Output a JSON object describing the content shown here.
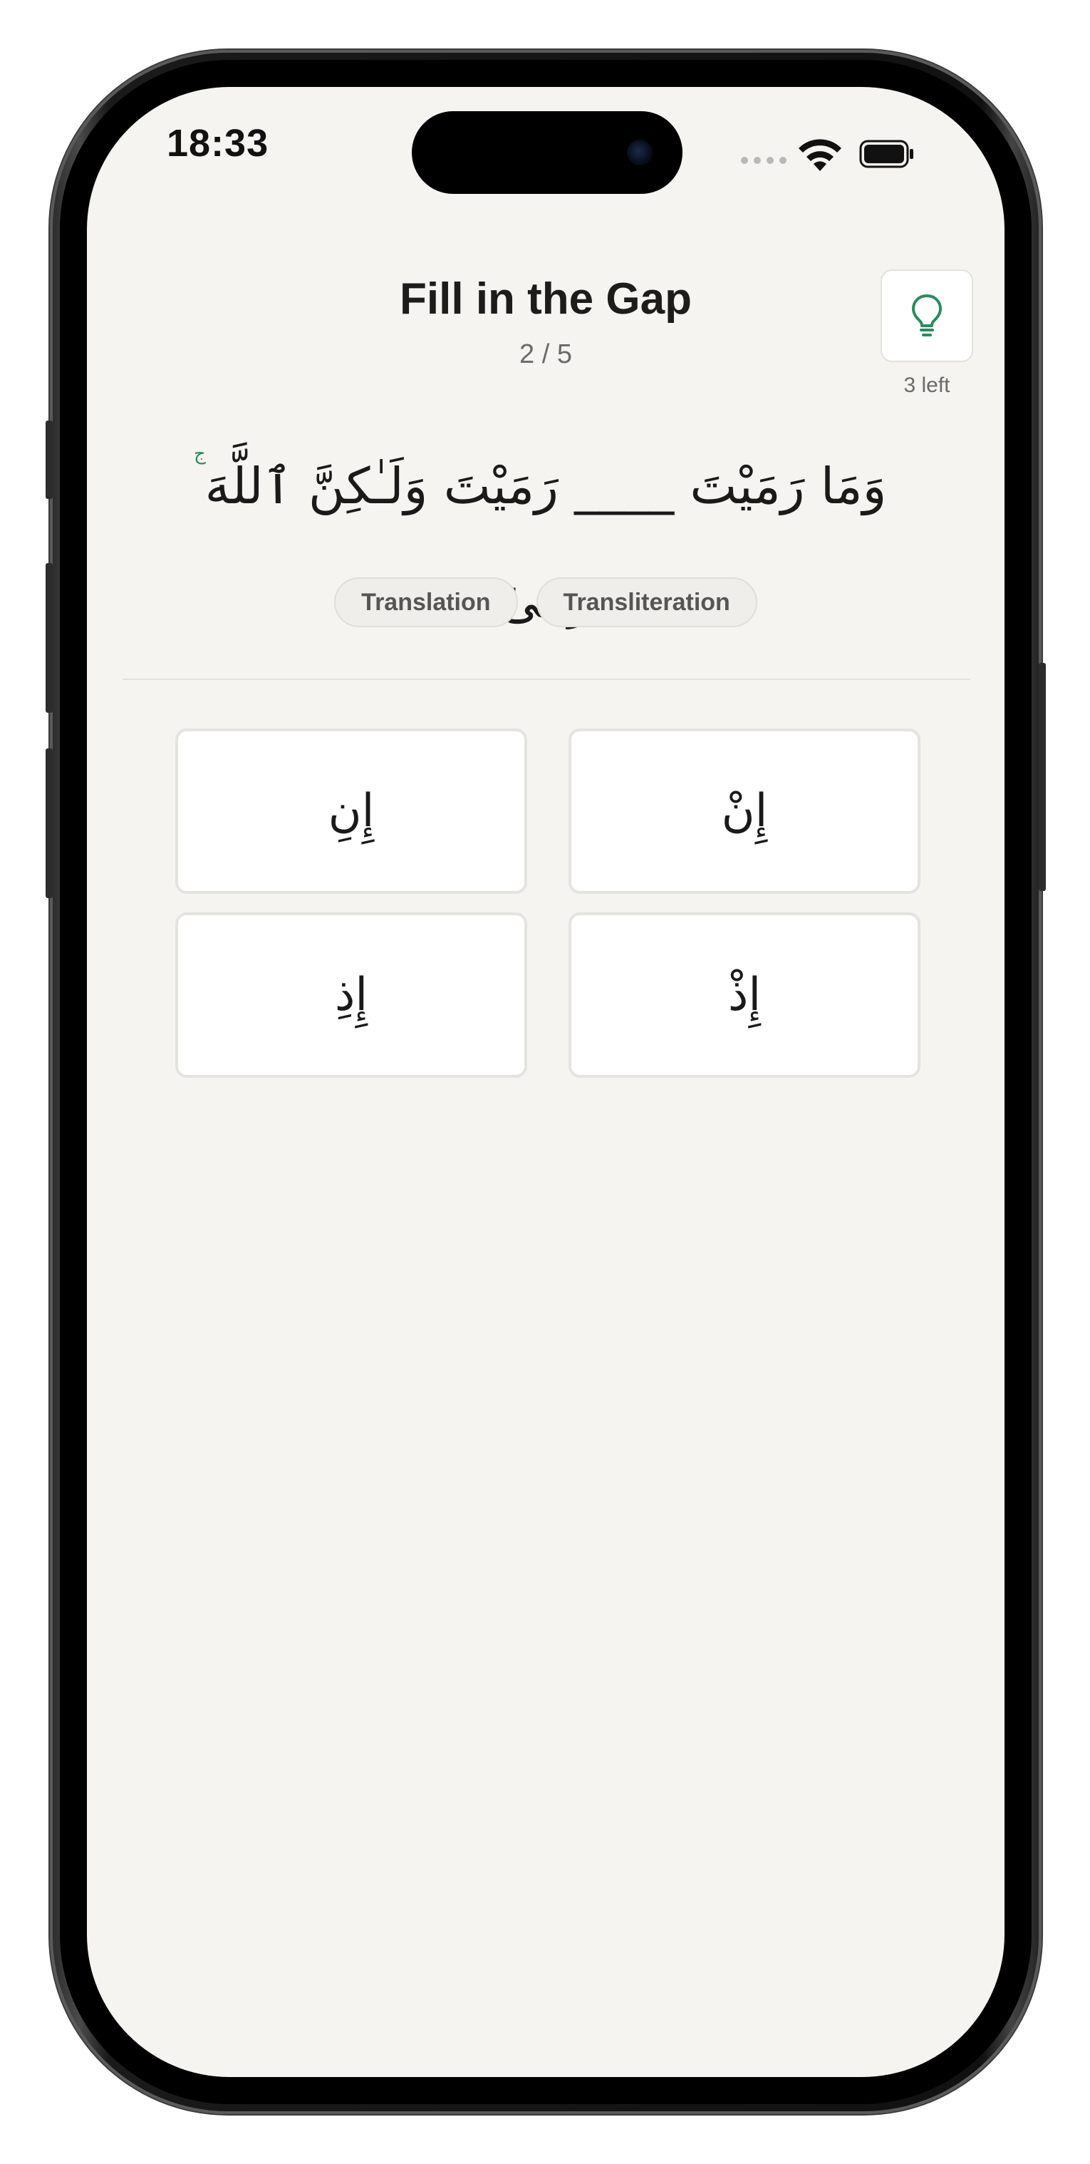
{
  "status_bar": {
    "time": "18:33"
  },
  "header": {
    "title": "Fill in the Gap",
    "progress": "2 / 5",
    "hint_remaining": "3 left",
    "hint_icon": "lightbulb-icon",
    "accent_color": "#2e8a5e"
  },
  "verse": {
    "text": "وَمَا رَمَيْتَ ____ رَمَيْتَ وَلَـٰكِنَّ ٱللَّهَ رَمَىٰ",
    "waqf_mark": "ج"
  },
  "toggles": {
    "translation": "Translation",
    "transliteration": "Transliteration"
  },
  "options": [
    {
      "label": "إِنِ"
    },
    {
      "label": "إِنْ"
    },
    {
      "label": "إِذِ"
    },
    {
      "label": "إِذْ"
    }
  ]
}
